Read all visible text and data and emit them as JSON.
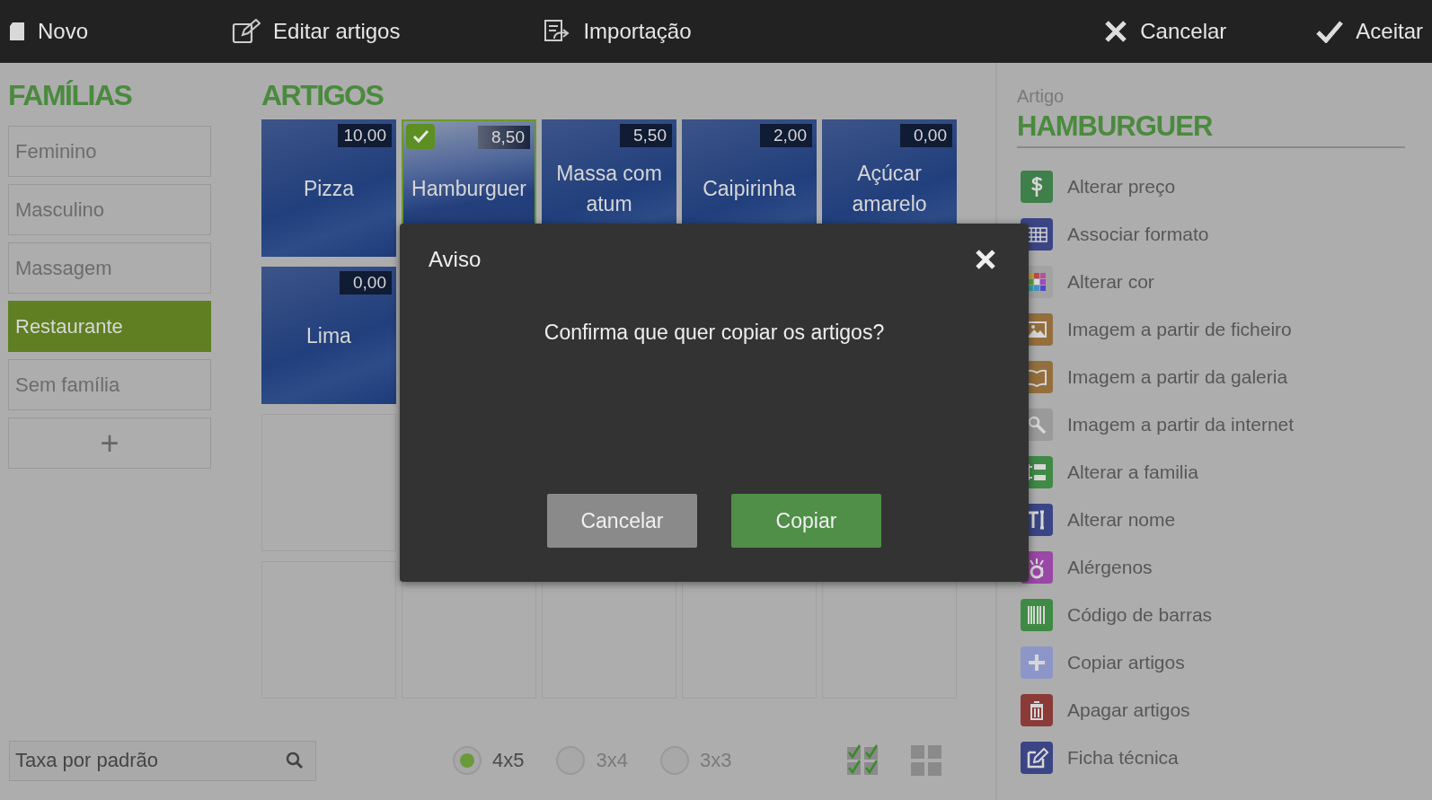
{
  "toolbar": {
    "left": [
      {
        "label": "Novo"
      },
      {
        "label": "Editar artigos"
      },
      {
        "label": "Importação"
      }
    ],
    "right": [
      {
        "label": "Cancelar"
      },
      {
        "label": "Aceitar"
      }
    ]
  },
  "families": {
    "title": "FAMÍLIAS",
    "items": [
      {
        "label": "Feminino",
        "selected": false
      },
      {
        "label": "Masculino",
        "selected": false
      },
      {
        "label": "Massagem",
        "selected": false
      },
      {
        "label": "Restaurante",
        "selected": true
      },
      {
        "label": "Sem família",
        "selected": false
      }
    ],
    "add_button": "+"
  },
  "articles": {
    "title": "ARTIGOS",
    "tiles": [
      {
        "name": "Pizza",
        "price": "10,00",
        "selected": false
      },
      {
        "name": "Hamburguer",
        "price": "8,50",
        "selected": true
      },
      {
        "name": "Massa com atum",
        "price": "5,50",
        "selected": false
      },
      {
        "name": "Caipirinha",
        "price": "2,00",
        "selected": false
      },
      {
        "name": "Açúcar amarelo",
        "price": "0,00",
        "selected": false
      },
      {
        "name": "Lima",
        "price": "0,00",
        "selected": false
      }
    ]
  },
  "bottom_bar": {
    "tax_field": {
      "placeholder": "Taxa por padrão"
    },
    "layouts": [
      {
        "label": "4x5",
        "selected": true
      },
      {
        "label": "3x4",
        "selected": false
      },
      {
        "label": "3x3",
        "selected": false
      }
    ]
  },
  "detail": {
    "caption": "Artigo",
    "title": "HAMBURGUER",
    "actions": [
      {
        "label": "Alterar preço"
      },
      {
        "label": "Associar formato"
      },
      {
        "label": "Alterar cor"
      },
      {
        "label": "Imagem a partir de ficheiro"
      },
      {
        "label": "Imagem a partir da galeria"
      },
      {
        "label": "Imagem a partir da internet"
      },
      {
        "label": "Alterar a familia"
      },
      {
        "label": "Alterar nome"
      },
      {
        "label": "Alérgenos"
      },
      {
        "label": "Código de barras"
      },
      {
        "label": "Copiar artigos"
      },
      {
        "label": "Apagar artigos"
      },
      {
        "label": "Ficha técnica"
      }
    ]
  },
  "dialog": {
    "title": "Aviso",
    "message": "Confirma que quer copiar os artigos?",
    "buttons": [
      {
        "label": "Cancelar",
        "kind": "secondary"
      },
      {
        "label": "Copiar",
        "kind": "primary"
      }
    ]
  }
}
